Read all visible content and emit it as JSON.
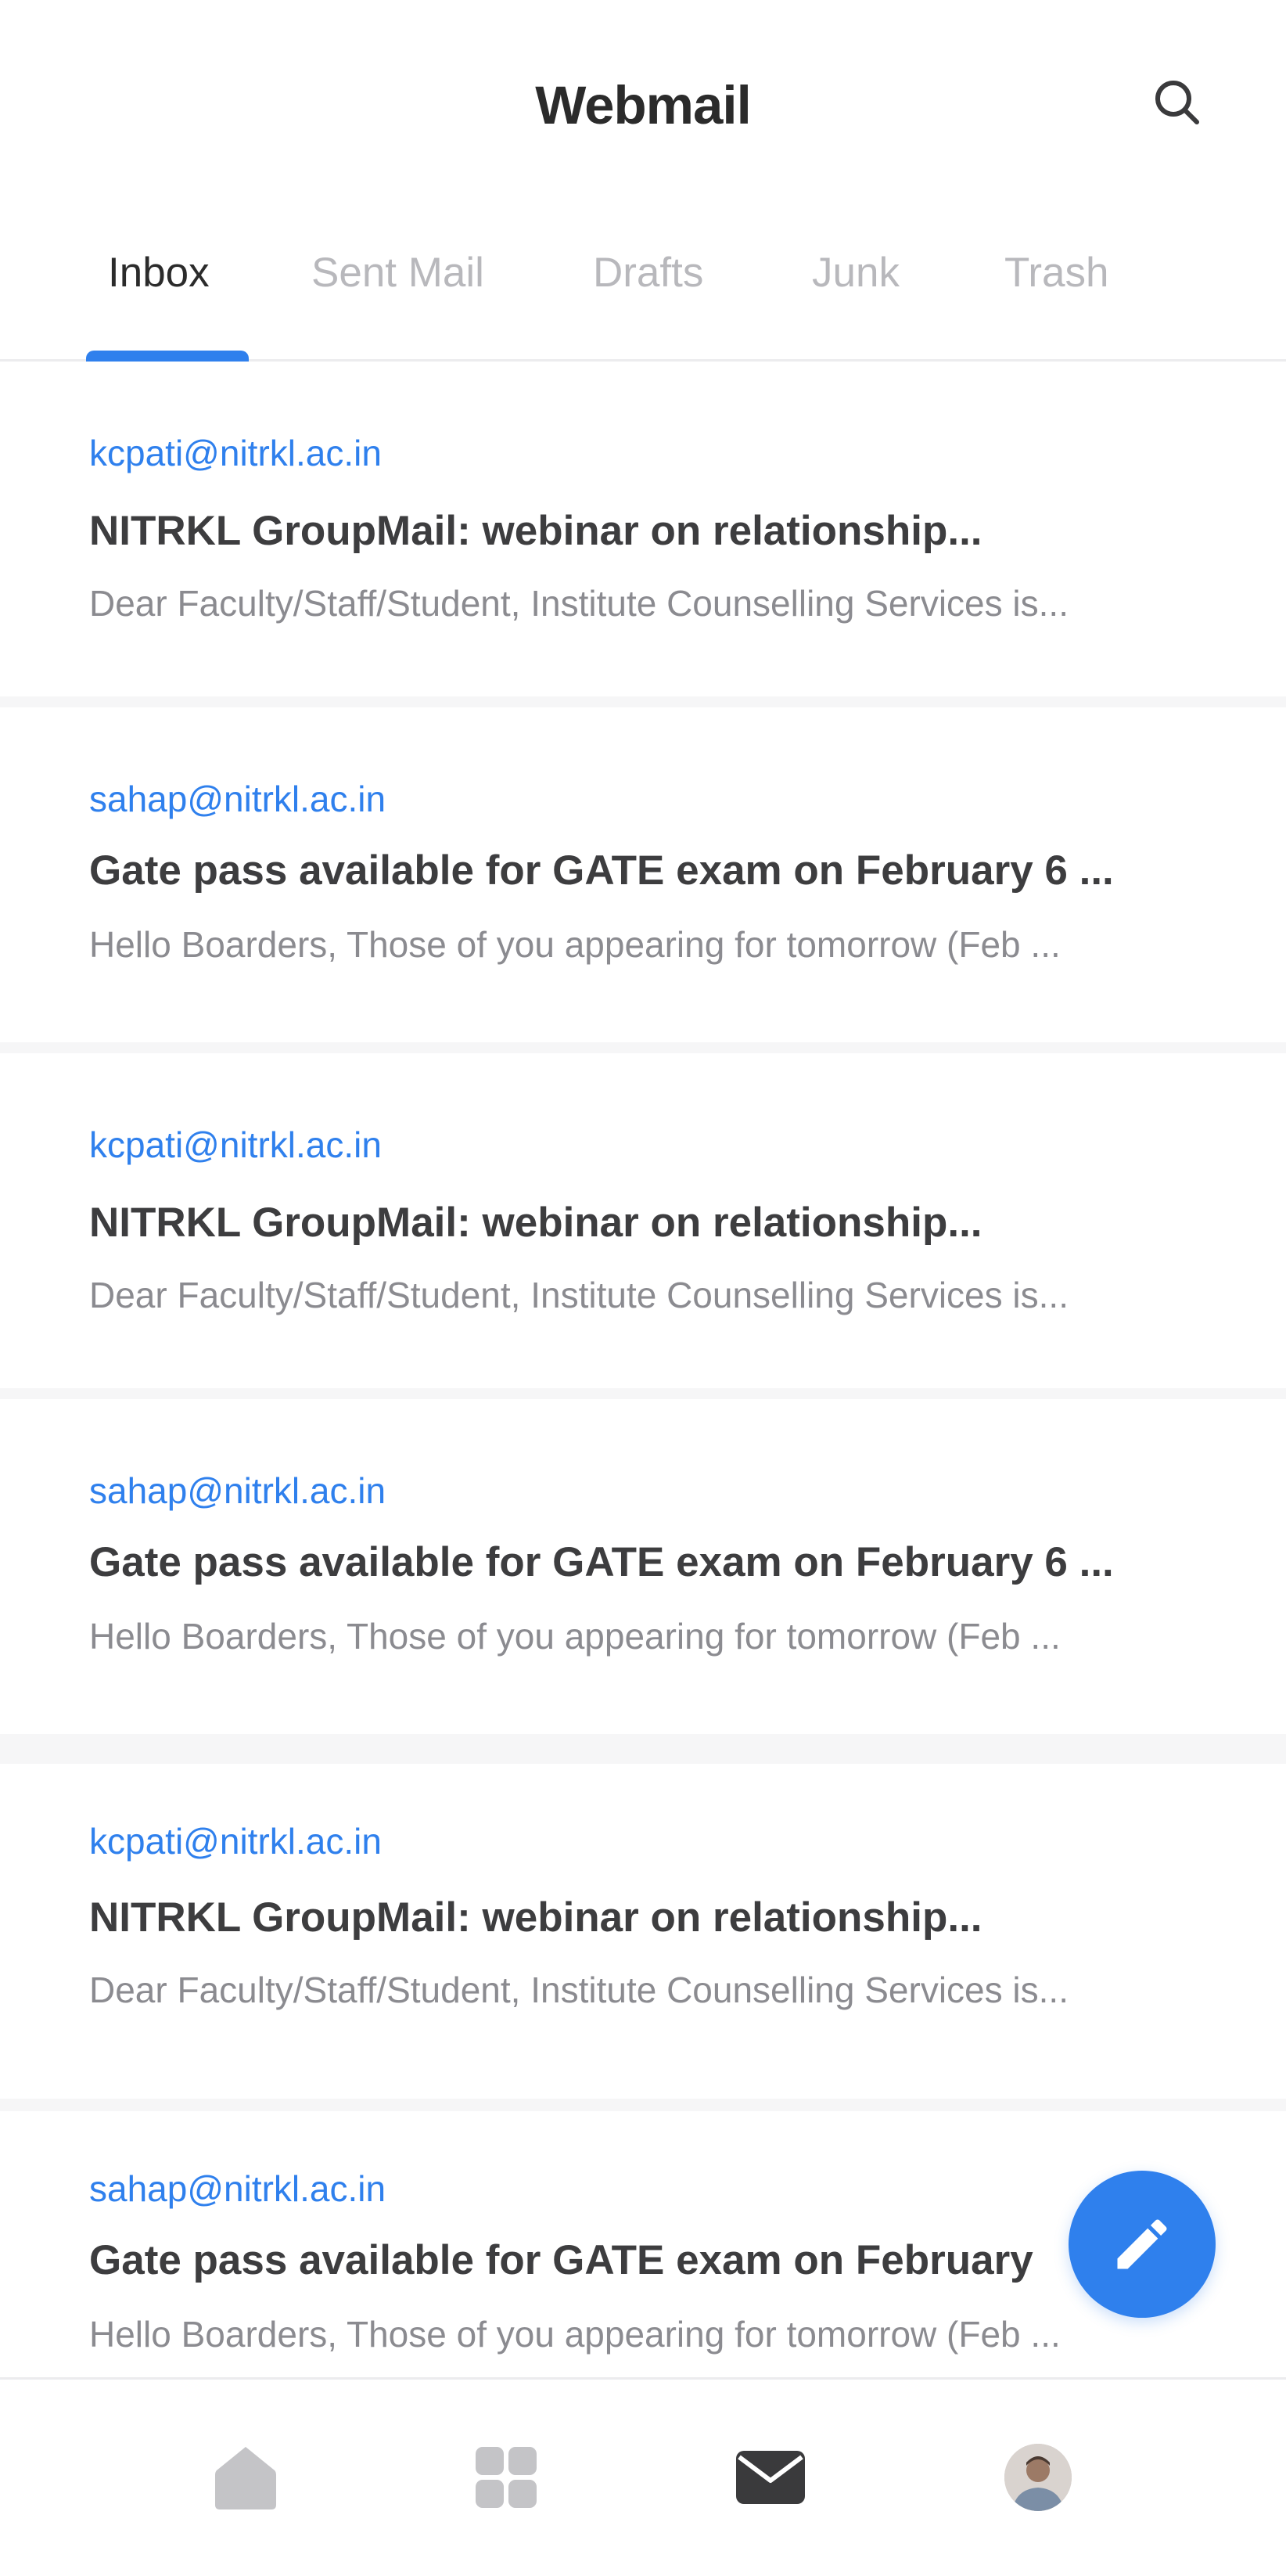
{
  "header": {
    "title": "Webmail",
    "search_icon": "search-icon"
  },
  "tabs": [
    {
      "label": "Inbox",
      "active": true
    },
    {
      "label": "Sent Mail",
      "active": false
    },
    {
      "label": "Drafts",
      "active": false
    },
    {
      "label": "Junk",
      "active": false
    },
    {
      "label": "Trash",
      "active": false
    }
  ],
  "emails": [
    {
      "from": "kcpati@nitrkl.ac.in",
      "subject": "NITRKL GroupMail: webinar on relationship...",
      "preview": "Dear Faculty/Staff/Student, Institute Counselling Services is..."
    },
    {
      "from": "sahap@nitrkl.ac.in",
      "subject": "Gate pass available for GATE exam on February 6 ...",
      "preview": "Hello Boarders, Those of you appearing for tomorrow (Feb ..."
    },
    {
      "from": "kcpati@nitrkl.ac.in",
      "subject": "NITRKL GroupMail: webinar on relationship...",
      "preview": "Dear Faculty/Staff/Student, Institute Counselling Services is..."
    },
    {
      "from": "sahap@nitrkl.ac.in",
      "subject": "Gate pass available for GATE exam on February 6 ...",
      "preview": "Hello Boarders, Those of you appearing for tomorrow (Feb ..."
    },
    {
      "from": "kcpati@nitrkl.ac.in",
      "subject": "NITRKL GroupMail: webinar on relationship...",
      "preview": "Dear Faculty/Staff/Student, Institute Counselling Services is..."
    },
    {
      "from": "sahap@nitrkl.ac.in",
      "subject": "Gate pass available for GATE exam on February",
      "preview": "Hello Boarders, Those of you appearing for tomorrow (Feb ..."
    }
  ],
  "fab": {
    "icon": "pencil-icon"
  },
  "bottom_nav": [
    {
      "icon": "home-icon",
      "active": false
    },
    {
      "icon": "grid-icon",
      "active": false
    },
    {
      "icon": "mail-icon",
      "active": true
    },
    {
      "icon": "avatar",
      "active": false
    }
  ],
  "colors": {
    "accent": "#2f80ed",
    "title_text": "#2b2b2b",
    "inactive_tab": "#b8b8bc",
    "preview_text": "#8b8b90",
    "inactive_icon": "#c4c4c7",
    "active_icon": "#3a3a3c"
  }
}
